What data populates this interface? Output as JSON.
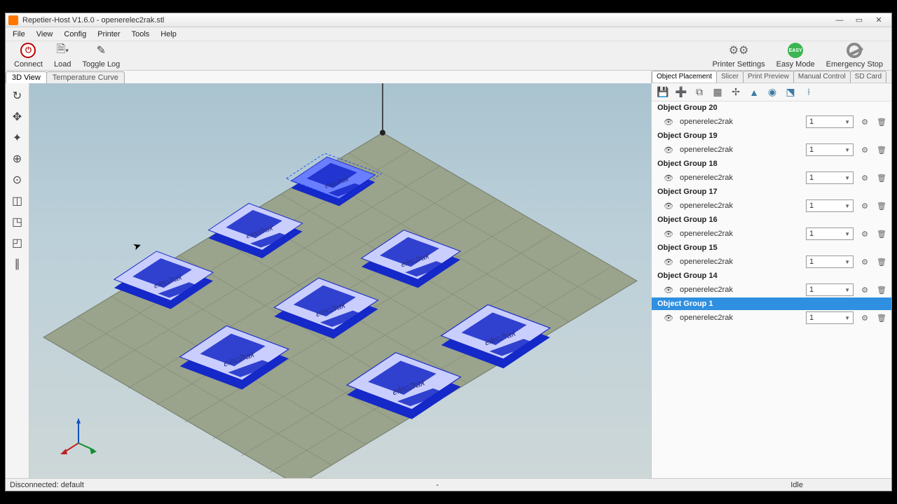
{
  "window": {
    "title": "Repetier-Host V1.6.0 - openerelec2rak.stl"
  },
  "menu": {
    "items": [
      "File",
      "View",
      "Config",
      "Printer",
      "Tools",
      "Help"
    ]
  },
  "toolbar": {
    "connect": "Connect",
    "load": "Load",
    "toggleLog": "Toggle Log",
    "printerSettings": "Printer Settings",
    "easyMode": "Easy Mode",
    "emergencyStop": "Emergency Stop",
    "easyBadge": "EASY"
  },
  "viewTabs": {
    "active": "3D View",
    "inactive": "Temperature Curve"
  },
  "panelTabs": [
    "Object Placement",
    "Slicer",
    "Print Preview",
    "Manual Control",
    "SD Card"
  ],
  "objects": {
    "fileName": "openerelec2rak",
    "countValue": "1",
    "groups": [
      {
        "label": "Object Group 20",
        "selected": false
      },
      {
        "label": "Object Group 19",
        "selected": false
      },
      {
        "label": "Object Group 18",
        "selected": false
      },
      {
        "label": "Object Group 17",
        "selected": false
      },
      {
        "label": "Object Group 16",
        "selected": false
      },
      {
        "label": "Object Group 15",
        "selected": false
      },
      {
        "label": "Object Group 14",
        "selected": false
      },
      {
        "label": "Object Group 1",
        "selected": true
      }
    ]
  },
  "status": {
    "left": "Disconnected: default",
    "center": "-",
    "right": "Idle"
  },
  "modelText": "elec2rak"
}
